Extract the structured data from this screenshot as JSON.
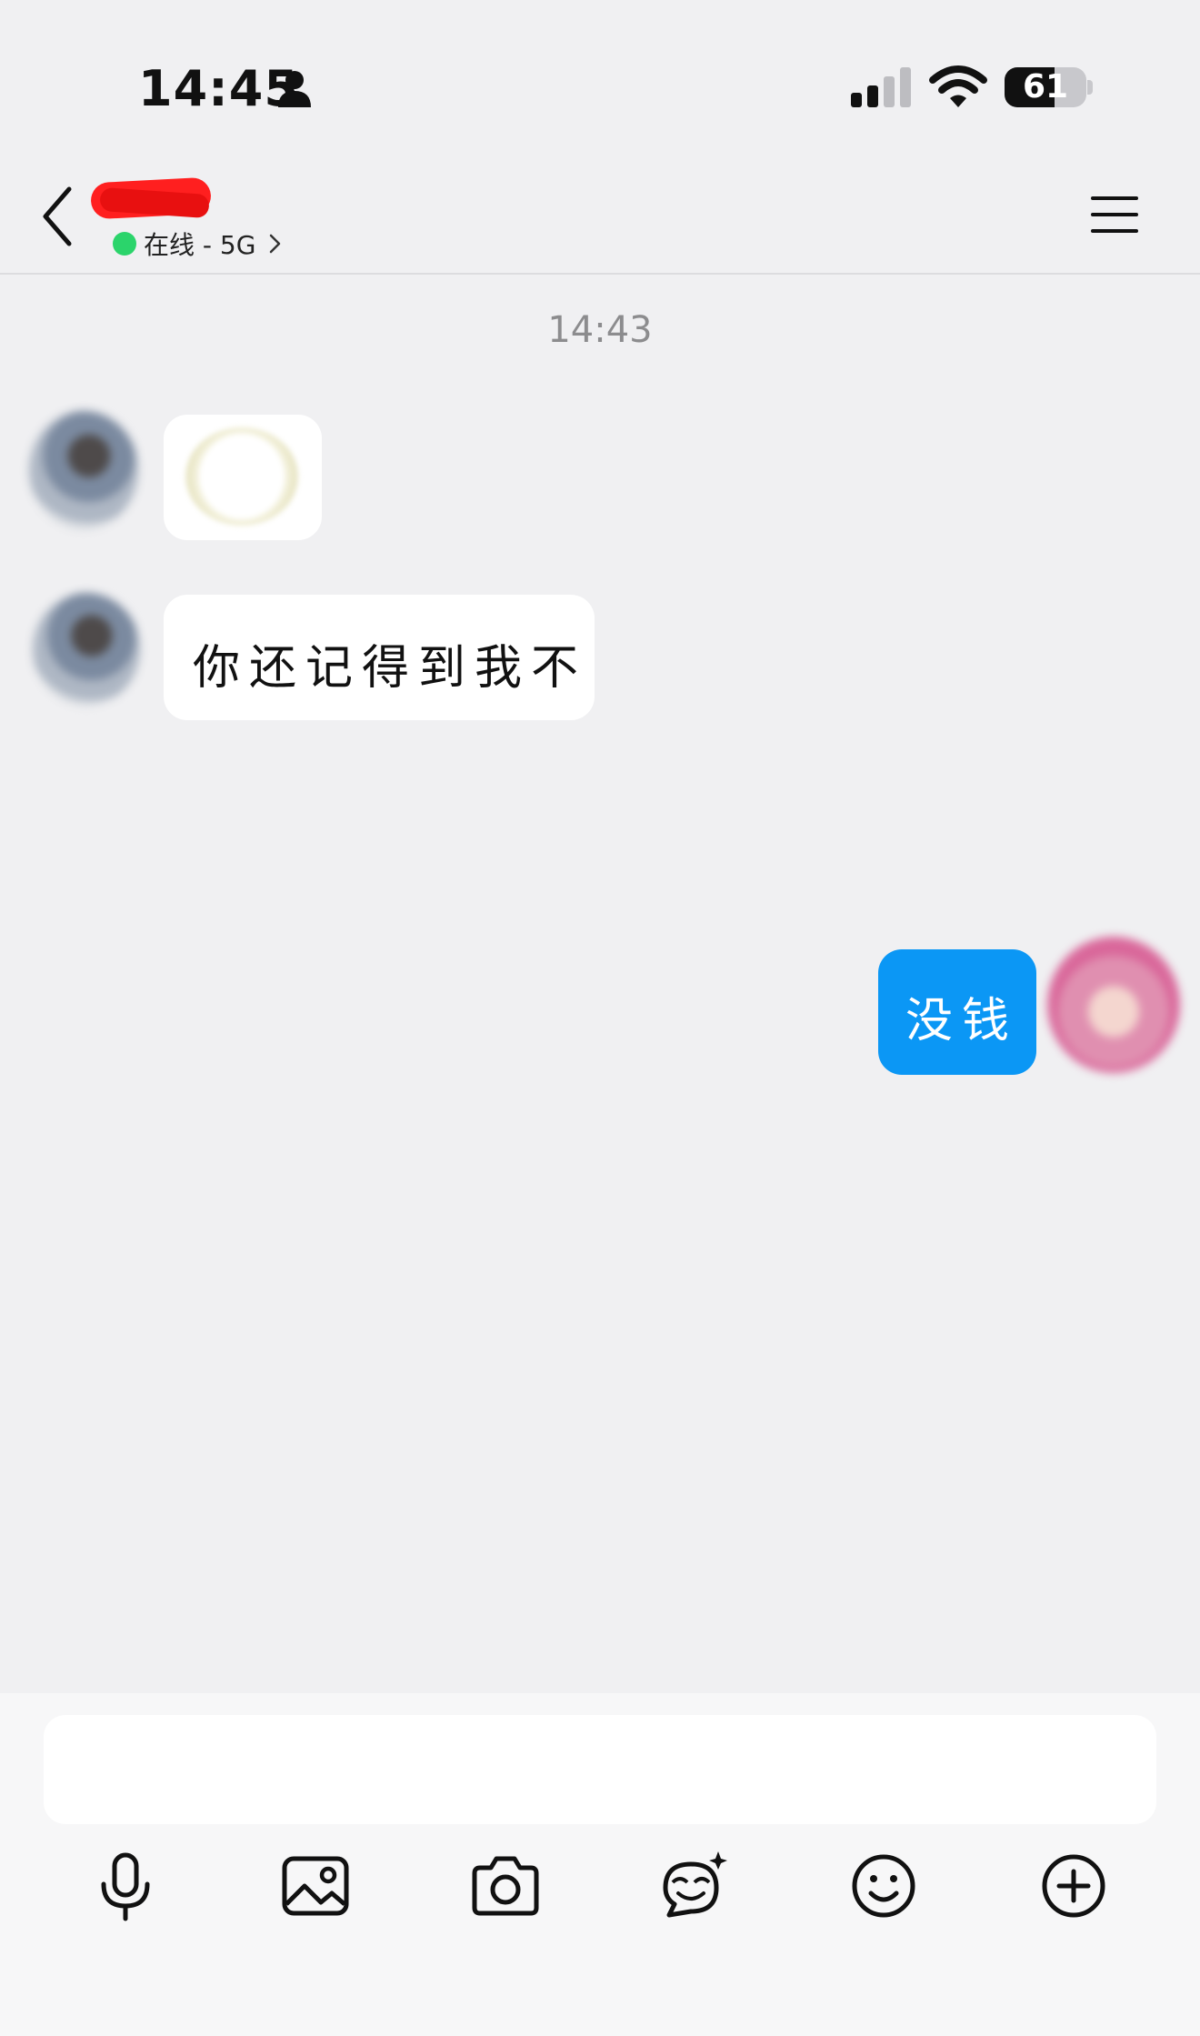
{
  "status_bar": {
    "time": "14:45",
    "battery_level": 61,
    "battery_label": "61",
    "icons": [
      "person-icon",
      "cellular-signal-icon",
      "wifi-icon",
      "battery-icon"
    ]
  },
  "nav": {
    "back_icon": "chevron-left-icon",
    "presence_status": "在线 - 5G",
    "presence_color": "#2bd46b",
    "menu_icon": "hamburger-menu-icon"
  },
  "chat": {
    "timestamp": "14:43",
    "messages": [
      {
        "direction": "in",
        "kind": "sticker",
        "text": ""
      },
      {
        "direction": "in",
        "kind": "text",
        "text": "你还记得到我不"
      },
      {
        "direction": "out",
        "kind": "text",
        "text": "没钱"
      }
    ],
    "outgoing_bubble_color": "#0b97f5",
    "incoming_bubble_color": "#ffffff"
  },
  "composer": {
    "input_value": "",
    "placeholder": "",
    "tools": [
      "microphone-icon",
      "image-icon",
      "camera-icon",
      "sticker-face-icon",
      "emoji-icon",
      "plus-circle-icon"
    ]
  }
}
